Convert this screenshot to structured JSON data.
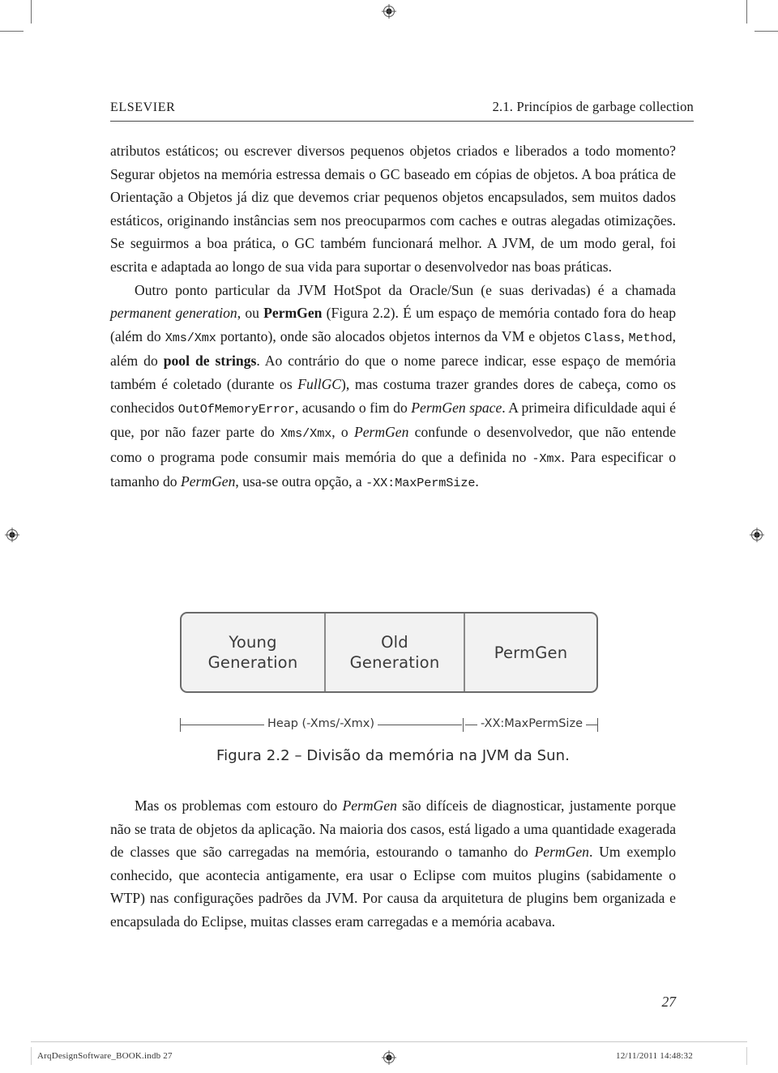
{
  "running_head": {
    "publisher": "ELSEVIER",
    "section": "2.1. Princípios de garbage collection"
  },
  "body": {
    "paragraph_1_parts": {
      "a": "atributos estáticos; ou escrever diversos pequenos objetos criados e liberados a todo momento? Segurar objetos na memória estressa demais o GC baseado em cópias de objetos. A boa prática de Orientação a Objetos já diz que devemos criar pequenos objetos encapsulados, sem muitos dados estáticos, originando instâncias sem nos preocuparmos com caches e outras alegadas otimizações. Se seguirmos a boa prática, o GC também funcionará melhor. A JVM, de um modo geral, foi escrita e adaptada ao longo de sua vida para suportar o desenvolvedor nas boas práticas."
    },
    "paragraph_2_parts": {
      "a": "Outro ponto particular da JVM HotSpot da Oracle/Sun (e suas derivadas) é a chamada ",
      "b_italic": "permanent generation",
      "c": ", ou ",
      "d_bold": "PermGen",
      "e": " (Figura 2.2). É um espaço de memória contado fora do heap (além do ",
      "f_mono": "Xms/Xmx",
      "g": " portanto), onde são alocados objetos internos da VM e objetos ",
      "h_mono": "Class",
      "i": ", ",
      "j_mono": "Method",
      "k": ", além do ",
      "l_bold": "pool de strings",
      "m": ". Ao contrário do que o nome parece indicar, esse espaço de memória também é coletado (durante os ",
      "n_italic": "FullGC",
      "o": "), mas costuma trazer grandes dores de cabeça, como os conhecidos ",
      "p_mono": "OutOfMemoryError",
      "q": ", acusando o fim do ",
      "r_italic": "PermGen space",
      "s": ". A primeira dificuldade aqui é que, por não fazer parte do ",
      "t_mono": "Xms/Xmx",
      "u": ", o ",
      "v_italic": "PermGen",
      "w": " confunde o desenvolvedor, que não entende como o programa pode consumir mais memória do que a definida no ",
      "x_mono": "-Xmx",
      "y": ". Para especificar o tamanho do ",
      "z_italic": "PermGen",
      "aa": ", usa-se outra opção, a ",
      "ab_mono": "-XX:MaxPermSize",
      "ac": "."
    },
    "paragraph_3_parts": {
      "a": "Mas os problemas com estouro do ",
      "b_italic": "PermGen",
      "c": " são difíceis de diagnosticar, justamente porque não se trata de objetos da aplicação. Na maioria dos casos, está ligado a uma quantidade exagerada de classes que são carregadas na memória, estourando o tamanho do ",
      "d_italic": "PermGen",
      "e": ". Um exemplo conhecido, que acontecia antigamente, era usar o Eclipse com muitos plugins (sabidamente o WTP) nas configurações padrões da JVM. Por causa da arquitetura de plugins bem organizada e encapsulada do Eclipse, muitas classes eram carregadas e a memória acabava."
    }
  },
  "figure": {
    "cells": [
      {
        "line1": "Young",
        "line2": "Generation"
      },
      {
        "line1": "Old",
        "line2": "Generation"
      },
      {
        "line1": "PermGen",
        "line2": ""
      }
    ],
    "dimension_labels": {
      "heap": "Heap (-Xms/-Xmx)",
      "permgen": "-XX:MaxPermSize"
    },
    "caption": "Figura 2.2 – Divisão da memória na JVM da Sun.",
    "colors": {
      "cell_fill": "#f2f2f2",
      "cell_border": "#6b6b6b",
      "divider": "#8a8a8a",
      "text": "#3a3a3a"
    }
  },
  "folio": {
    "page_number": "27"
  },
  "footer": {
    "file_slug": "ArqDesignSoftware_BOOK.indb   27",
    "timestamp": "12/11/2011   14:48:32"
  },
  "marks": {
    "registration_icon": "registration-target-icon",
    "crop_icon": "crop-mark"
  }
}
